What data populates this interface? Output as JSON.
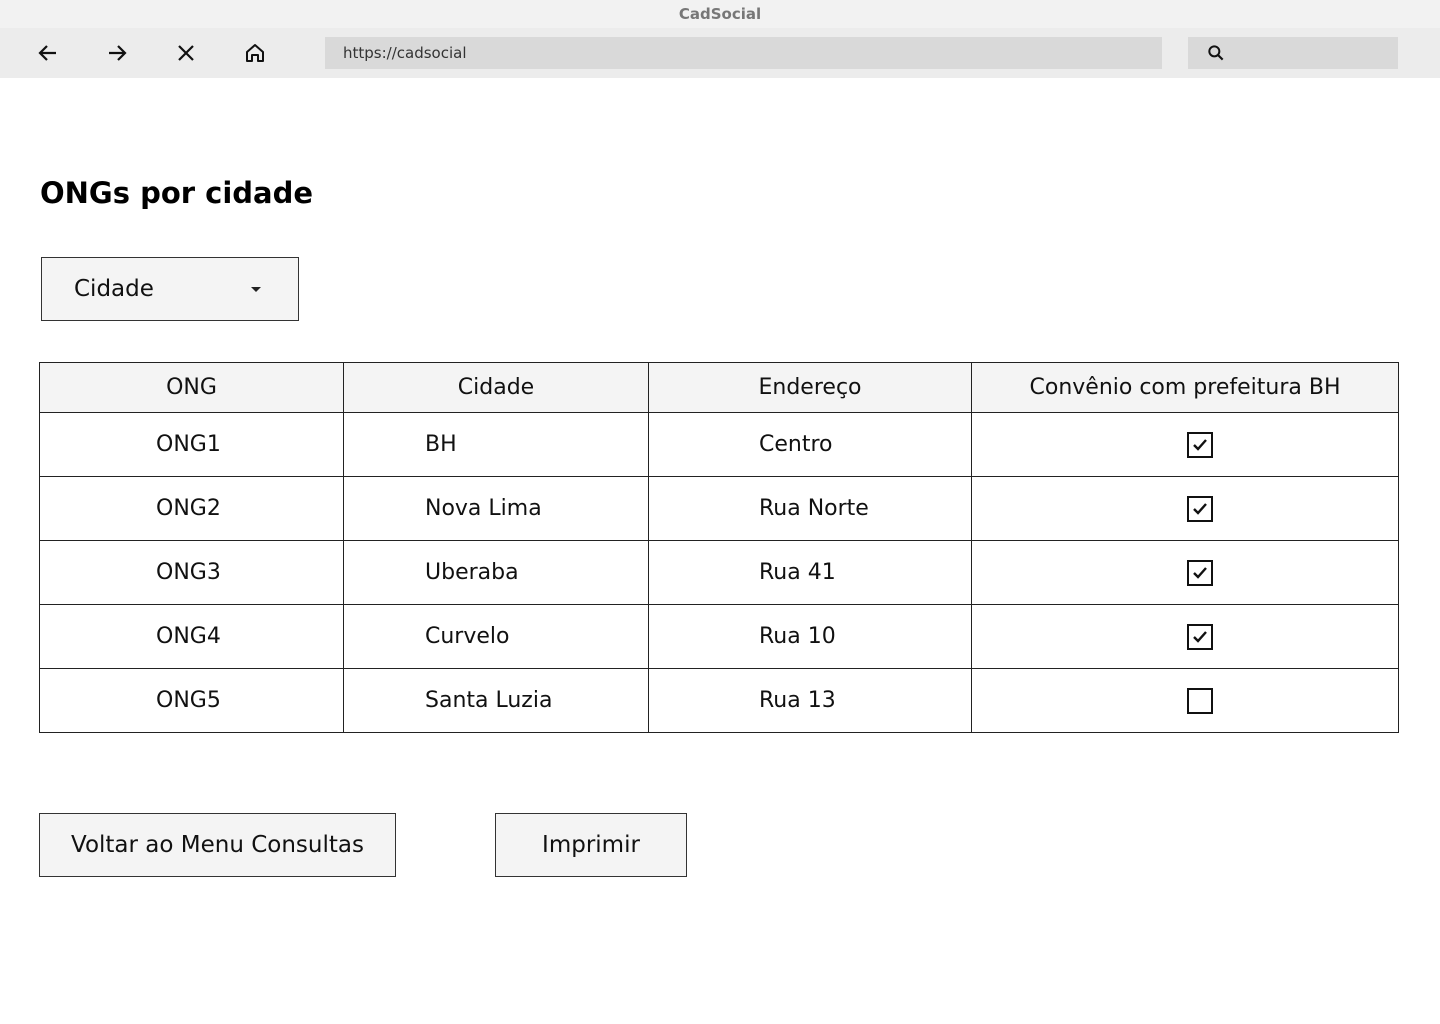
{
  "window": {
    "title": "CadSocial"
  },
  "toolbar": {
    "url": "https://cadsocial"
  },
  "page": {
    "title": "ONGs por cidade"
  },
  "filter": {
    "selected": "Cidade"
  },
  "table": {
    "headers": [
      "ONG",
      "Cidade",
      "Endereço",
      "Convênio com prefeitura BH"
    ],
    "rows": [
      {
        "ong": "ONG1",
        "cidade": "BH",
        "endereco": "Centro",
        "convenio": true
      },
      {
        "ong": "ONG2",
        "cidade": "Nova Lima",
        "endereco": "Rua Norte",
        "convenio": true
      },
      {
        "ong": "ONG3",
        "cidade": "Uberaba",
        "endereco": "Rua 41",
        "convenio": true
      },
      {
        "ong": "ONG4",
        "cidade": "Curvelo",
        "endereco": "Rua 10",
        "convenio": true
      },
      {
        "ong": "ONG5",
        "cidade": "Santa Luzia",
        "endereco": "Rua 13",
        "convenio": false
      }
    ]
  },
  "buttons": {
    "back": "Voltar ao Menu Consultas",
    "print": "Imprimir"
  }
}
